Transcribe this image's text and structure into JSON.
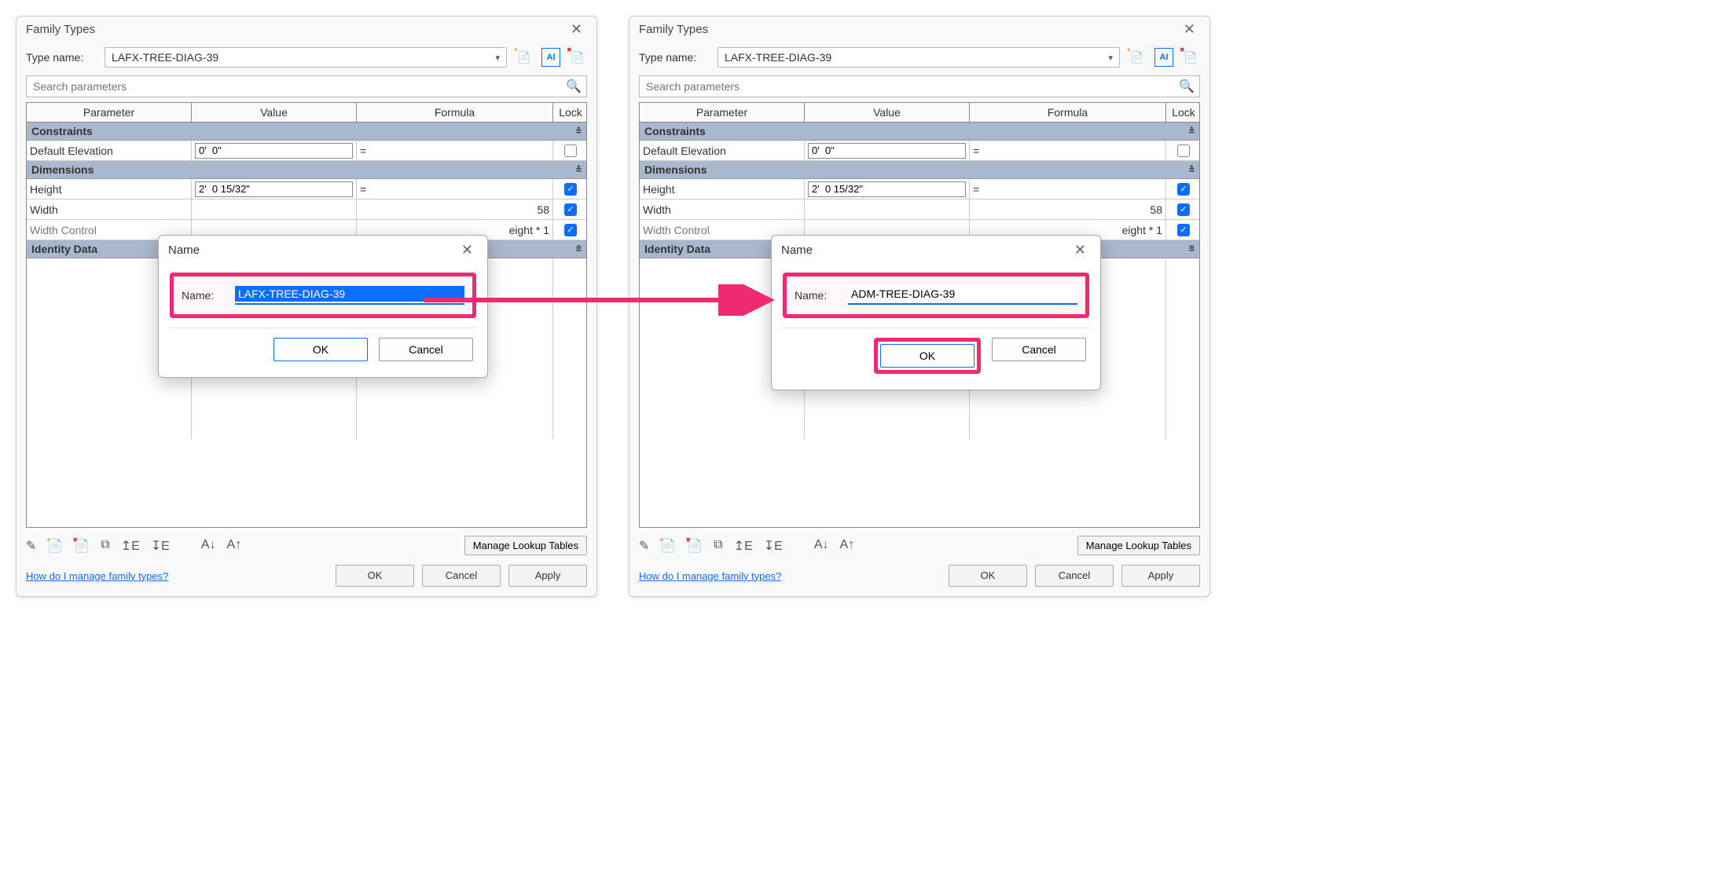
{
  "left": {
    "title": "Family Types",
    "typeLabel": "Type name:",
    "typeValue": "LAFX-TREE-DIAG-39",
    "searchPlaceholder": "Search parameters",
    "headers": {
      "param": "Parameter",
      "value": "Value",
      "formula": "Formula",
      "lock": "Lock"
    },
    "sections": {
      "constraints": "Constraints",
      "dimensions": "Dimensions",
      "identity": "Identity Data"
    },
    "rows": {
      "defElev": {
        "param": "Default Elevation",
        "value": "0'  0\"",
        "formula": "=",
        "locked": false
      },
      "height": {
        "param": "Height",
        "value": "2'  0 15/32\"",
        "formula": "=",
        "locked": true
      },
      "width": {
        "param": "Width",
        "value_tail": "58",
        "locked": true
      },
      "widthCtrl": {
        "param": "Width Control",
        "formula_tail": "eight * 1",
        "locked": true
      }
    },
    "dialog": {
      "title": "Name",
      "label": "Name:",
      "value": "LAFX-TREE-DIAG-39",
      "ok": "OK",
      "cancel": "Cancel"
    },
    "lookup": "Manage Lookup Tables",
    "help": "How do I manage family types?",
    "footer": {
      "ok": "OK",
      "cancel": "Cancel",
      "apply": "Apply"
    }
  },
  "right": {
    "title": "Family Types",
    "typeLabel": "Type name:",
    "typeValue": "LAFX-TREE-DIAG-39",
    "searchPlaceholder": "Search parameters",
    "headers": {
      "param": "Parameter",
      "value": "Value",
      "formula": "Formula",
      "lock": "Lock"
    },
    "sections": {
      "constraints": "Constraints",
      "dimensions": "Dimensions",
      "identity": "Identity Data"
    },
    "rows": {
      "defElev": {
        "param": "Default Elevation",
        "value": "0'  0\"",
        "formula": "=",
        "locked": false
      },
      "height": {
        "param": "Height",
        "value": "2'  0 15/32\"",
        "formula": "=",
        "locked": true
      },
      "width": {
        "param": "Width",
        "value_tail": "58",
        "locked": true
      },
      "widthCtrl": {
        "param": "Width Control",
        "formula_tail": "eight * 1",
        "locked": true
      }
    },
    "dialog": {
      "title": "Name",
      "label": "Name:",
      "value": "ADM-TREE-DIAG-39",
      "ok": "OK",
      "cancel": "Cancel"
    },
    "lookup": "Manage Lookup Tables",
    "help": "How do I manage family types?",
    "footer": {
      "ok": "OK",
      "cancel": "Cancel",
      "apply": "Apply"
    }
  }
}
